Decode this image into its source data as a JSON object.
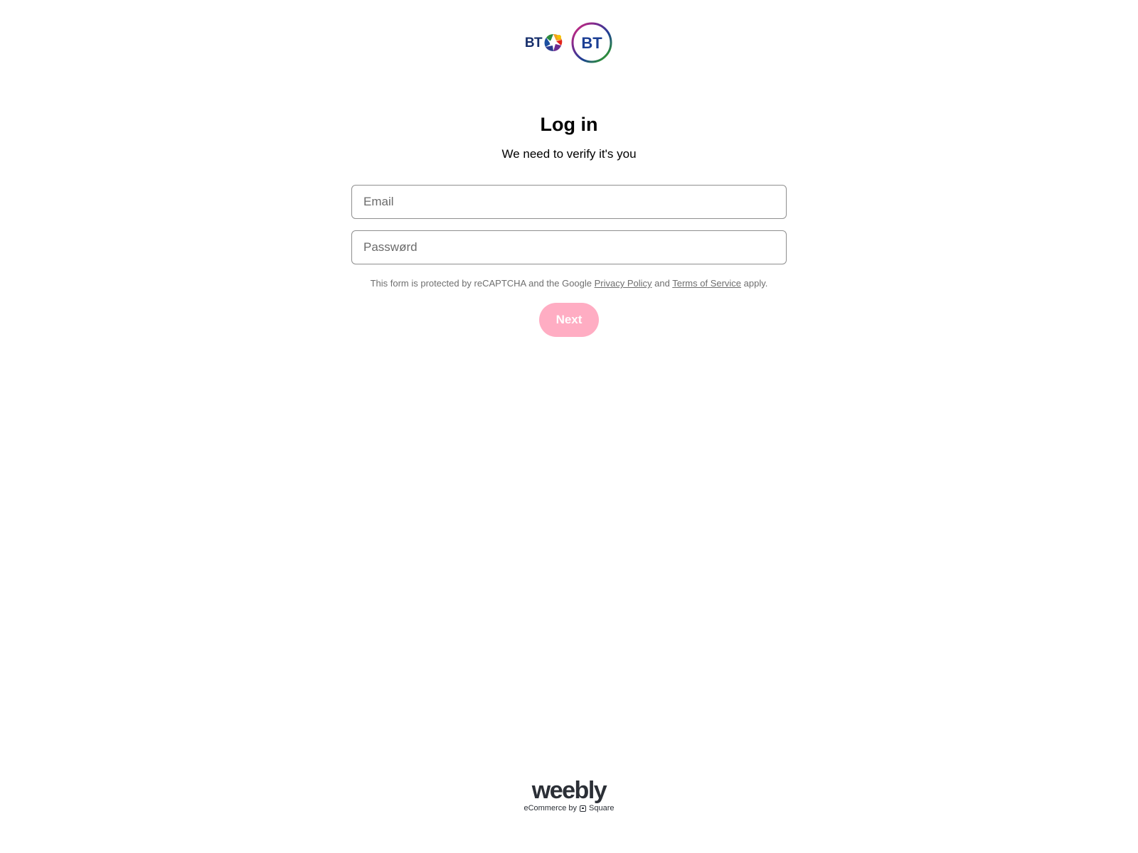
{
  "header": {
    "logo_classic_text": "BT",
    "logo_roundel_text": "BT"
  },
  "login": {
    "title": "Log in",
    "subtitle": "We need to verify it's you",
    "email_placeholder": "Email",
    "email_value": "",
    "password_placeholder": "Passwørd",
    "password_value": "",
    "legal_prefix": "This form is protected by reCAPTCHA and the Google ",
    "privacy_link": "Privacy Policy",
    "legal_and": " and ",
    "terms_link": "Terms of Service",
    "legal_suffix": " apply.",
    "next_label": "Next"
  },
  "footer": {
    "brand": "weebly",
    "powered_prefix": "eCommerce by",
    "powered_brand": "Square"
  },
  "colors": {
    "button_bg": "#ffadc3",
    "bt_blue": "#162e6b",
    "roundel_blue": "#1c3f94",
    "text_muted": "#6f6f6f"
  }
}
